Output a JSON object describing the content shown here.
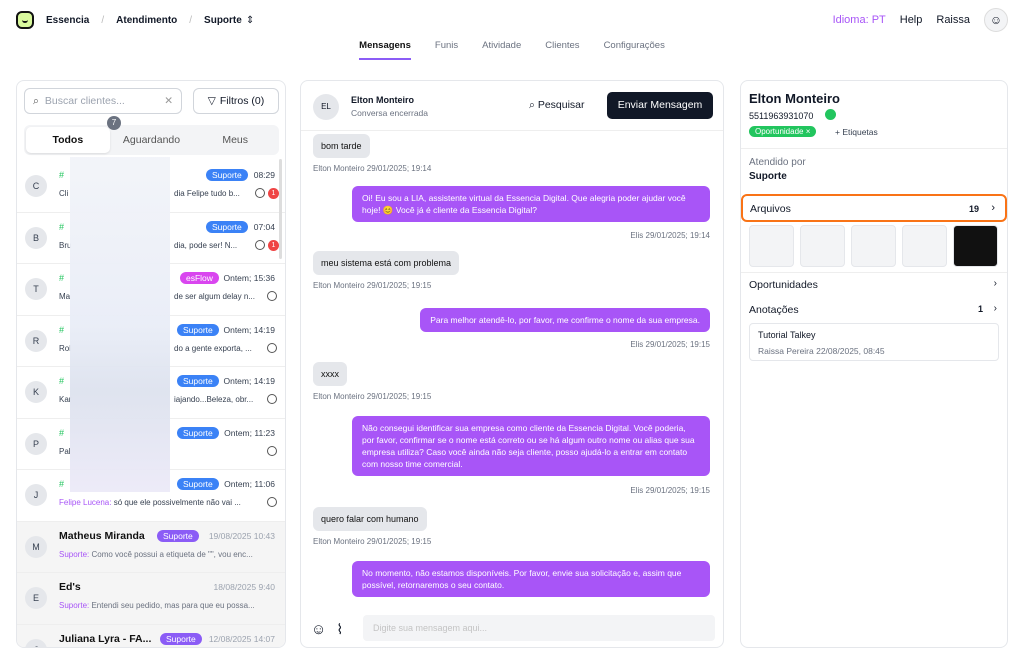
{
  "breadcrumb": [
    "Essencia",
    "Atendimento",
    "Suporte"
  ],
  "topright": {
    "idioma": "Idioma: PT",
    "help": "Help",
    "user": "Raissa"
  },
  "nav": [
    "Mensagens",
    "Funis",
    "Atividade",
    "Clientes",
    "Configurações"
  ],
  "left": {
    "search_placeholder": "Buscar clientes...",
    "filtros": "Filtros (0)",
    "tabs": [
      "Todos",
      "Aguardando",
      "Meus"
    ],
    "aguardando_badge": "7",
    "items": [
      {
        "av": "C",
        "tag": "Suporte",
        "tag_color": "#3b82f6",
        "time": "08:29",
        "prev": "Cli",
        "prev2": "dia Felipe tudo b...",
        "unread": "1"
      },
      {
        "av": "B",
        "tag": "Suporte",
        "tag_color": "#3b82f6",
        "time": "07:04",
        "prev": "Bru",
        "prev2": "dia, pode ser! N...",
        "unread": "1"
      },
      {
        "av": "T",
        "tag": "esFlow",
        "tag_color": "#d946ef",
        "time": "Ontem; 15:36",
        "prev": "Ma",
        "prev2": "de ser algum delay n..."
      },
      {
        "av": "R",
        "tag": "Suporte",
        "tag_color": "#3b82f6",
        "time": "Ontem; 14:19",
        "prev": "Rol",
        "prev2": "do a gente exporta, ..."
      },
      {
        "av": "K",
        "tag": "Suporte",
        "tag_color": "#3b82f6",
        "time": "Ontem; 14:19",
        "prev": "Kar",
        "prev2": "iajando...Beleza, obr..."
      },
      {
        "av": "P",
        "tag": "Suporte",
        "tag_color": "#3b82f6",
        "time": "Ontem; 11:23",
        "prev": "Pal",
        "prev2": ""
      },
      {
        "av": "J",
        "tag": "Suporte",
        "tag_color": "#3b82f6",
        "time": "Ontem; 11:06",
        "prev": "Felipe Lucena:",
        "prev2": " só que ele possivelmente não vai ..."
      }
    ],
    "named": [
      {
        "av": "M",
        "name": "Matheus Miranda",
        "tag": "Suporte",
        "time": "19/08/2025 10:43",
        "from": "Suporte:",
        "msg": " Como você possui a etiqueta de \"\", vou enc..."
      },
      {
        "av": "E",
        "name": "Ed's",
        "tag": "",
        "time": "18/08/2025 9:40",
        "from": "Suporte:",
        "msg": " Entendi seu pedido, mas para que eu possa..."
      },
      {
        "av": "J",
        "name": "Juliana Lyra - FA...",
        "tag": "Suporte",
        "time": "12/08/2025 14:07",
        "from": "",
        "msg": ""
      }
    ]
  },
  "mid": {
    "avatar": "EL",
    "name": "Elton Monteiro",
    "status": "Conversa encerrada",
    "pesquisar": "Pesquisar",
    "enviar": "Enviar Mensagem",
    "input_placeholder": "Digite sua mensagem aqui...",
    "msgs": [
      {
        "dir": "in",
        "text": "bom tarde",
        "meta": "Elton Monteiro 29/01/2025; 19:14"
      },
      {
        "dir": "out",
        "text": "Oi! Eu sou a LIA, assistente virtual da Essencia Digital. Que alegria poder ajudar você hoje! 😊 Você já é cliente da Essencia Digital?",
        "meta": "Elis 29/01/2025; 19:14"
      },
      {
        "dir": "in",
        "text": "meu sistema está com problema",
        "meta": "Elton Monteiro 29/01/2025; 19:15"
      },
      {
        "dir": "out",
        "text": "Para melhor atendê-lo, por favor, me confirme o nome da sua empresa.",
        "meta": "Elis 29/01/2025; 19:15"
      },
      {
        "dir": "in",
        "text": "xxxx",
        "meta": "Elton Monteiro 29/01/2025; 19:15"
      },
      {
        "dir": "out",
        "text": "Não consegui identificar sua empresa como cliente da Essencia Digital. Você poderia, por favor, confirmar se o nome está correto ou se há algum outro nome ou alias que sua empresa utiliza? Caso você ainda não seja cliente, posso ajudá-lo a entrar em contato com nosso time comercial.",
        "meta": "Elis 29/01/2025; 19:15"
      },
      {
        "dir": "in",
        "text": "quero falar com humano",
        "meta": "Elton Monteiro 29/01/2025; 19:15"
      },
      {
        "dir": "out",
        "text": "No momento, não estamos disponíveis. Por favor, envie sua solicitação e, assim que possível, retornaremos o seu contato.",
        "meta": ""
      }
    ]
  },
  "right": {
    "name": "Elton Monteiro",
    "phone": "5511963931070",
    "tag": "Oportunidade",
    "etiquetas": "+ Etiquetas",
    "atendido_label": "Atendido por",
    "atendido": "Suporte",
    "arquivos": "Arquivos",
    "arquivos_count": "19",
    "oportunidades": "Oportunidades",
    "anotacoes": "Anotações",
    "anotacoes_count": "1",
    "note_title": "Tutorial Talkey",
    "note_meta": "Raissa Pereira 22/08/2025, 08:45"
  }
}
